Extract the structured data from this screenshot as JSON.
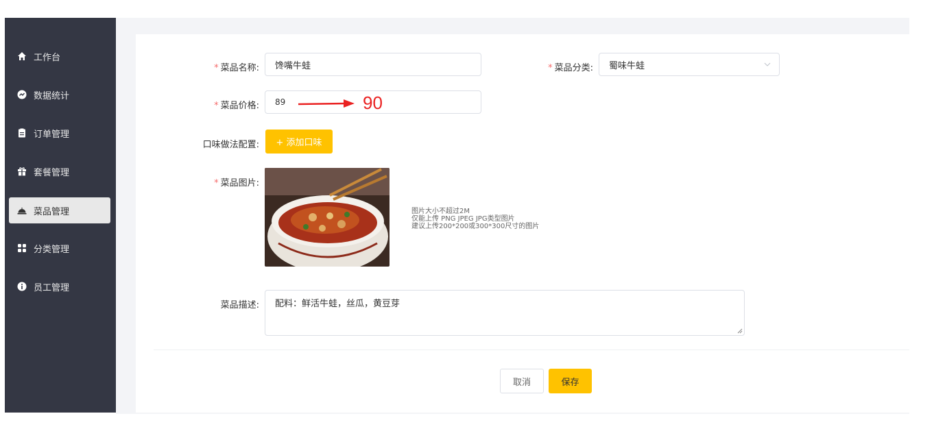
{
  "colors": {
    "sidebar_bg": "#343744",
    "accent": "#ffc200",
    "required": "#f56c6c",
    "annotation": "#ea2222"
  },
  "sidebar": {
    "items": [
      {
        "label": "工作台",
        "icon": "home-icon"
      },
      {
        "label": "数据统计",
        "icon": "chart-icon"
      },
      {
        "label": "订单管理",
        "icon": "clipboard-icon"
      },
      {
        "label": "套餐管理",
        "icon": "gift-icon"
      },
      {
        "label": "菜品管理",
        "icon": "dish-icon",
        "active": true
      },
      {
        "label": "分类管理",
        "icon": "grid-icon"
      },
      {
        "label": "员工管理",
        "icon": "info-icon"
      }
    ]
  },
  "form": {
    "required_mark": "*",
    "name": {
      "label": "菜品名称:",
      "value": "馋嘴牛蛙"
    },
    "category": {
      "label": "菜品分类:",
      "value": "蜀味牛蛙"
    },
    "price": {
      "label": "菜品价格:",
      "value": "89"
    },
    "flavor": {
      "label": "口味做法配置:",
      "button": "+ 添加口味"
    },
    "image": {
      "label": "菜品图片:",
      "hints": [
        "图片大小不超过2M",
        "仅能上传 PNG JPEG JPG类型图片",
        "建议上传200*200或300*300尺寸的图片"
      ]
    },
    "description": {
      "label": "菜品描述:",
      "value": "配料：鲜活牛蛙，丝瓜，黄豆芽"
    }
  },
  "annotation": {
    "value": "90"
  },
  "actions": {
    "cancel": "取消",
    "save": "保存"
  }
}
